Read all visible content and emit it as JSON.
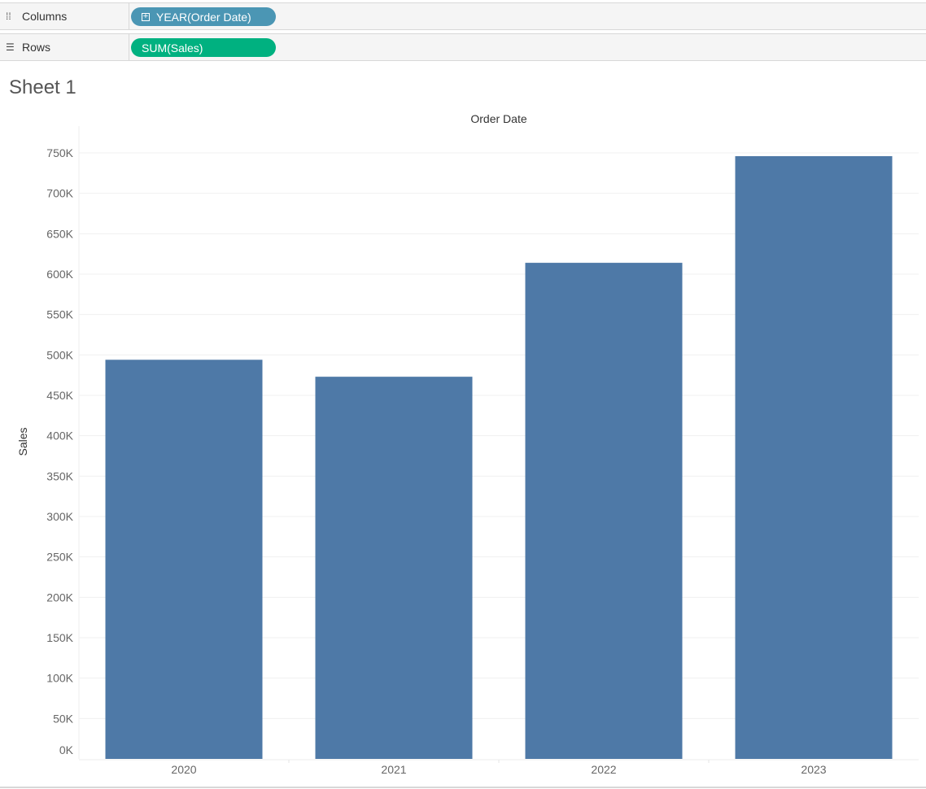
{
  "shelves": {
    "columns": {
      "label": "Columns",
      "icon": "columns-icon",
      "pill": "YEAR(Order Date)",
      "pill_color": "#4b96b4"
    },
    "rows": {
      "label": "Rows",
      "icon": "rows-icon",
      "pill": "SUM(Sales)",
      "pill_color": "#00b180"
    }
  },
  "sheet_title": "Sheet 1",
  "chart_data": {
    "type": "bar",
    "title": "",
    "column_header": "Order Date",
    "xlabel": "",
    "ylabel": "Sales",
    "categories": [
      "2020",
      "2021",
      "2022",
      "2023"
    ],
    "values": [
      494000,
      473000,
      614000,
      746000
    ],
    "ylim": [
      0,
      750000
    ],
    "yticks": [
      "0K",
      "50K",
      "100K",
      "150K",
      "200K",
      "250K",
      "300K",
      "350K",
      "400K",
      "450K",
      "500K",
      "550K",
      "600K",
      "650K",
      "700K",
      "750K"
    ],
    "grid": true,
    "bar_color": "#4e79a7"
  }
}
